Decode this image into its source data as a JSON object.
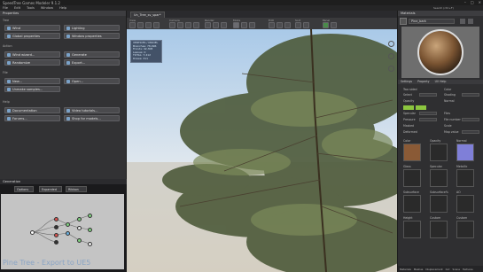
{
  "app": {
    "title": "SpeedTree Games Modeler 9.1.2"
  },
  "menu": [
    "File",
    "Edit",
    "Tools",
    "Window",
    "Help"
  ],
  "left_panel": {
    "title": "Properties",
    "sections": {
      "tree": "Tree",
      "action": "Action",
      "file": "File",
      "help": "Help"
    },
    "buttons": {
      "wind": "Wind",
      "lighting": "Lighting",
      "global_properties": "Global properties",
      "window_properties": "Window properties",
      "wind_wizard": "Wind wizard...",
      "generate": "Generate",
      "randomize": "Randomize",
      "export": "Export...",
      "new": "New...",
      "open": "Open...",
      "unmake_samples": "Unmake samples...",
      "documentation": "Documentation",
      "video_tutorials": "Video tutorials...",
      "forums": "Forums...",
      "shop_models": "Shop for models..."
    }
  },
  "graph_panel": {
    "title": "Generation",
    "tabs": [
      "Options",
      "Expanded",
      "Ribbon"
    ],
    "watermark": "Pine Tree - Export to UE5"
  },
  "viewport": {
    "tab": "Un_Tree_sv_spar*",
    "toolbar_groups": [
      "View",
      "Camera",
      "Render",
      "Mode",
      "Edit",
      "Sort",
      "Panel"
    ],
    "stats_lines": [
      "VERTICES / MODEL",
      "Branches: 78,096",
      "Fronds: 42,308",
      "Leaves: 0",
      "TOTAL: 7,412",
      "Draws: 311"
    ]
  },
  "right_panel": {
    "title": "Materials",
    "search_placeholder": "Search (ctrl+F)",
    "material_name": "Pine_bark",
    "tabs": [
      "Settings",
      "Property",
      "UV Help"
    ],
    "fields": [
      "Two sided",
      "Select",
      "Opacity",
      "Specular",
      "Pressure",
      "Masked",
      "Deformed"
    ],
    "right_fields": [
      "Color",
      "Shading",
      "Normal",
      "Files",
      "File number",
      "Scale",
      "Map value"
    ],
    "map_labels": [
      "Color",
      "Opacity",
      "Normal",
      "Gloss",
      "Specular",
      "Metallic",
      "Subsurface",
      "Subsurface%",
      "AO"
    ],
    "bottom_labels": [
      "Height",
      "Custom",
      "Custom"
    ],
    "footer": [
      "Materials",
      "Meshes",
      "Displacement",
      "Cut",
      "Scene",
      "Textures"
    ]
  }
}
